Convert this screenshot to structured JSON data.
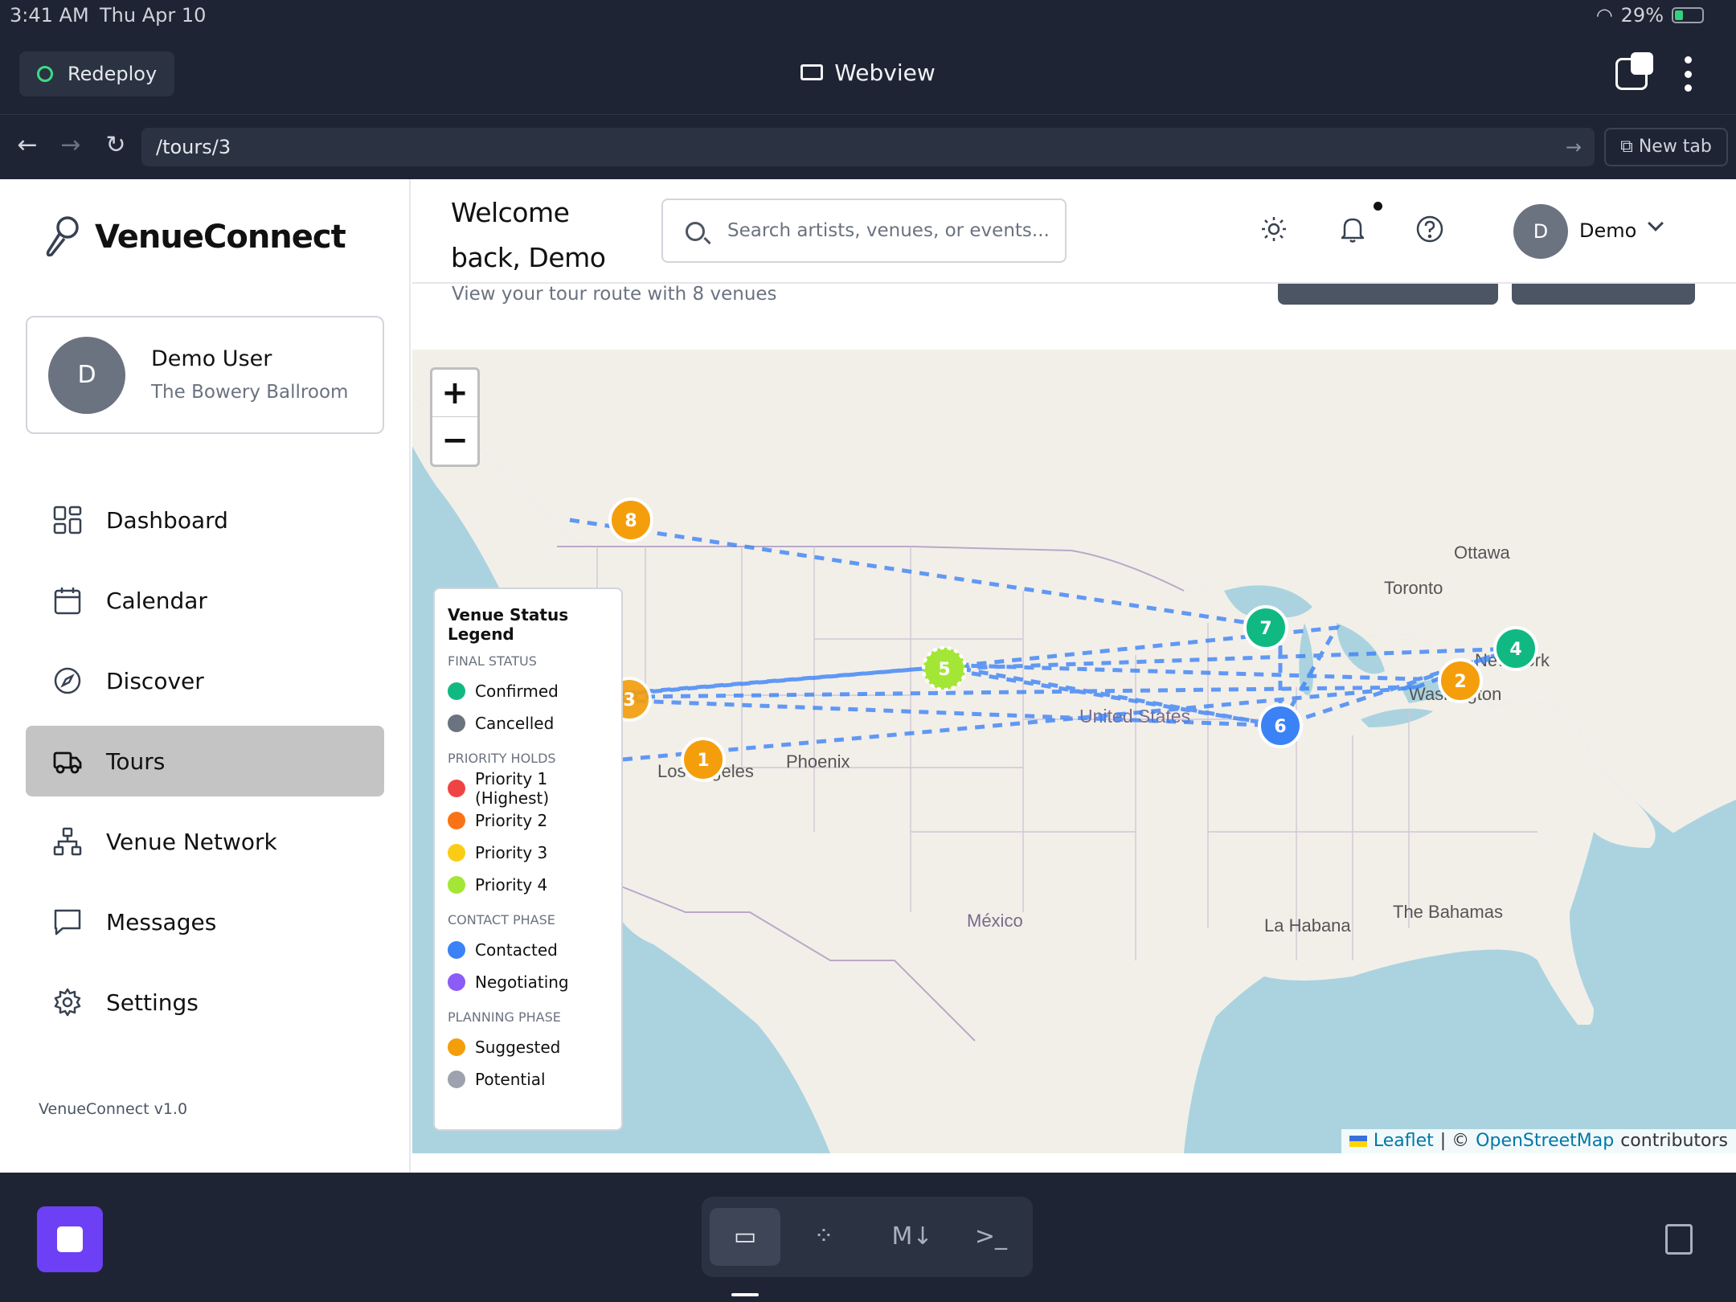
{
  "status_bar": {
    "time": "3:41 AM",
    "date": "Thu Apr 10",
    "battery": "29%"
  },
  "chrome": {
    "redeploy_label": "Redeploy",
    "title": "Webview",
    "url": "/tours/3",
    "new_tab_label": "New tab"
  },
  "sidebar": {
    "brand": "VenueConnect",
    "user": {
      "initial": "D",
      "name": "Demo User",
      "venue": "The Bowery Ballroom"
    },
    "items": [
      {
        "label": "Dashboard",
        "icon": "dashboard-icon"
      },
      {
        "label": "Calendar",
        "icon": "calendar-icon"
      },
      {
        "label": "Discover",
        "icon": "compass-icon"
      },
      {
        "label": "Tours",
        "icon": "truck-icon",
        "active": true
      },
      {
        "label": "Venue Network",
        "icon": "network-icon"
      },
      {
        "label": "Messages",
        "icon": "message-icon"
      },
      {
        "label": "Settings",
        "icon": "gear-icon"
      }
    ],
    "version": "VenueConnect v1.0"
  },
  "header": {
    "welcome": "Welcome back, Demo",
    "search_placeholder": "Search artists, venues, or events...",
    "user_initial": "D",
    "user_name": "Demo"
  },
  "page": {
    "subtitle": "View your tour route with 8 venues"
  },
  "map": {
    "zoom_in": "+",
    "zoom_out": "−",
    "place_labels": [
      "Ottawa",
      "Toronto",
      "Washington",
      "New York",
      "United States",
      "Phoenix",
      "Los Angeles",
      "México",
      "La Habana",
      "The Bahamas"
    ],
    "markers": [
      {
        "number": "1",
        "color": "#f59e0b"
      },
      {
        "number": "2",
        "color": "#f59e0b"
      },
      {
        "number": "3",
        "color": "#f59e0b"
      },
      {
        "number": "4",
        "color": "#10b981"
      },
      {
        "number": "5",
        "color": "#a3e635"
      },
      {
        "number": "6",
        "color": "#3b82f6"
      },
      {
        "number": "7",
        "color": "#10b981"
      },
      {
        "number": "8",
        "color": "#f59e0b"
      }
    ],
    "attribution": {
      "leaflet": "Leaflet",
      "sep": "| ©",
      "osm": "OpenStreetMap",
      "suffix": "contributors"
    }
  },
  "legend": {
    "title": "Venue Status Legend",
    "groups": [
      {
        "name": "FINAL STATUS",
        "items": [
          {
            "label": "Confirmed",
            "color": "#10b981"
          },
          {
            "label": "Cancelled",
            "color": "#6b7280"
          }
        ]
      },
      {
        "name": "PRIORITY HOLDS",
        "items": [
          {
            "label": "Priority 1 (Highest)",
            "color": "#ef4444"
          },
          {
            "label": "Priority 2",
            "color": "#f97316"
          },
          {
            "label": "Priority 3",
            "color": "#facc15"
          },
          {
            "label": "Priority 4",
            "color": "#a3e635"
          }
        ]
      },
      {
        "name": "CONTACT PHASE",
        "items": [
          {
            "label": "Contacted",
            "color": "#3b82f6"
          },
          {
            "label": "Negotiating",
            "color": "#8b5cf6"
          }
        ]
      },
      {
        "name": "PLANNING PHASE",
        "items": [
          {
            "label": "Suggested",
            "color": "#f59e0b"
          },
          {
            "label": "Potential",
            "color": "#9ca3af"
          }
        ]
      }
    ]
  },
  "dock": {
    "buttons": [
      "monitor-icon",
      "grid-icon",
      "markdown-icon",
      "terminal-icon"
    ]
  }
}
